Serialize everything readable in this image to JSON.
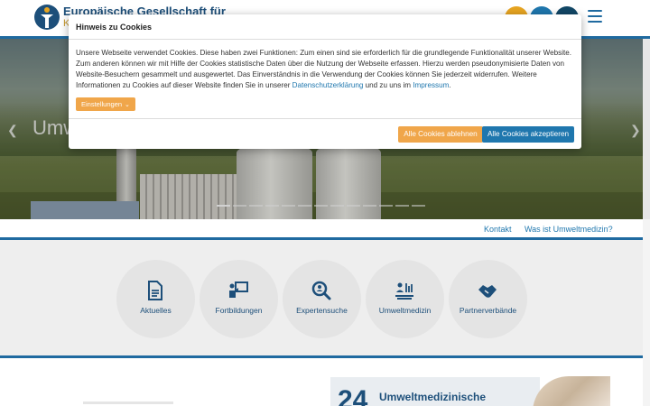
{
  "header": {
    "site_title": "Europäische Gesellschaft für",
    "site_sub": "K",
    "icons": [
      "logo-figure-icon",
      "orange-circle-icon",
      "blue-circle-icon",
      "navy-circle-icon",
      "menu-icon"
    ]
  },
  "hero": {
    "headline": "Umwelt"
  },
  "top_links": {
    "kontakt": "Kontakt",
    "was_ist": "Was ist Umweltmedizin?"
  },
  "features": [
    {
      "label": "Aktuelles",
      "icon": "document-icon"
    },
    {
      "label": "Fortbildungen",
      "icon": "presenter-icon"
    },
    {
      "label": "Expertensuche",
      "icon": "search-person-icon"
    },
    {
      "label": "Umweltmedizin",
      "icon": "environment-icon"
    },
    {
      "label": "Partnerverbände",
      "icon": "handshake-icon"
    }
  ],
  "teaser": {
    "number": "24",
    "title": "Umweltmedizinische"
  },
  "cookie_dialog": {
    "title": "Hinweis zu Cookies",
    "body_text": "Unsere Webseite verwendet Cookies. Diese haben zwei Funktionen: Zum einen sind sie erforderlich für die grundlegende Funktionalität unserer Website. Zum anderen können wir mit Hilfe der Cookies statistische Daten über die Nutzung der Webseite erfassen. Hierzu werden pseudonymisierte Daten von Website-Besuchern gesammelt und ausgewertet. Das Einverständnis in die Verwendung der Cookies können Sie jederzeit widerrufen. Weitere Informationen zu Cookies auf dieser Website finden Sie in unserer ",
    "privacy_link": "Datenschutzerklärung",
    "between": " und zu uns im ",
    "imprint_link": "Impressum",
    "end": ".",
    "settings_label": "Einstellungen",
    "decline_label": "Alle Cookies ablehnen",
    "accept_label": "Alle Cookies akzeptieren"
  },
  "colors": {
    "brand_blue": "#1f77ae",
    "brand_orange": "#f0a64a",
    "dark_blue": "#1d4f7a"
  }
}
